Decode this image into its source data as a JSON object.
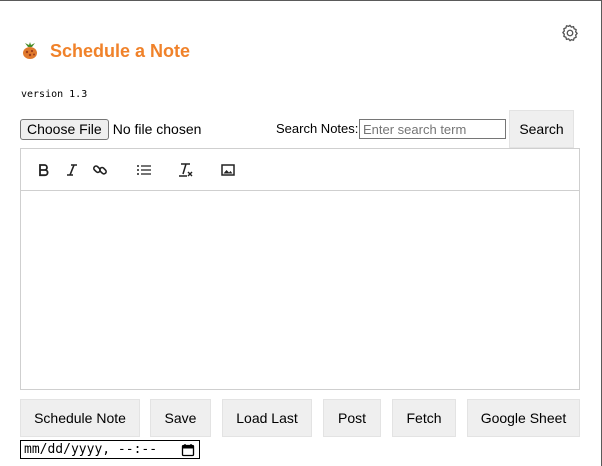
{
  "app": {
    "title": "Schedule a Note",
    "version": "version 1.3",
    "accent_color": "#f0822a"
  },
  "icons": {
    "settings": "gear-icon",
    "logo": "fruit-logo-icon"
  },
  "file": {
    "button_label": "Choose File",
    "status": "No file chosen"
  },
  "search": {
    "label": "Search Notes:",
    "placeholder": "Enter search term",
    "value": "",
    "button_label": "Search"
  },
  "editor": {
    "toolbar": [
      "bold-icon",
      "italic-icon",
      "link-icon",
      "bullet-list-icon",
      "clear-format-icon",
      "image-icon"
    ],
    "content": ""
  },
  "actions": {
    "schedule_note": "Schedule Note",
    "save": "Save",
    "load_last": "Load Last",
    "post": "Post",
    "fetch": "Fetch",
    "google_sheet": "Google Sheet"
  },
  "datetime": {
    "value": "mm/dd/yyyy, --:-- "
  }
}
